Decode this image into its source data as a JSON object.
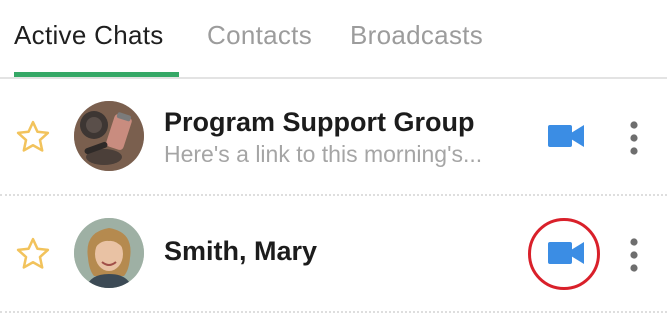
{
  "tabs": [
    {
      "label": "Active Chats",
      "active": true
    },
    {
      "label": "Contacts",
      "active": false
    },
    {
      "label": "Broadcasts",
      "active": false
    }
  ],
  "chats": [
    {
      "name": "Program Support Group",
      "preview": "Here's a link to this morning's...",
      "favorite": false,
      "avatar_icon": "group-photo-avatar",
      "action_icons": [
        "star-outline-icon",
        "video-camera-icon",
        "more-vert-icon"
      ]
    },
    {
      "name": "Smith, Mary",
      "preview": "",
      "favorite": false,
      "avatar_icon": "person-photo-avatar",
      "action_icons": [
        "star-outline-icon",
        "video-camera-icon",
        "more-vert-icon"
      ]
    }
  ],
  "colors": {
    "accent_green": "#35a866",
    "video_blue": "#3b8de4",
    "star_outline": "#f2c35c",
    "highlight_red": "#d9202a"
  }
}
